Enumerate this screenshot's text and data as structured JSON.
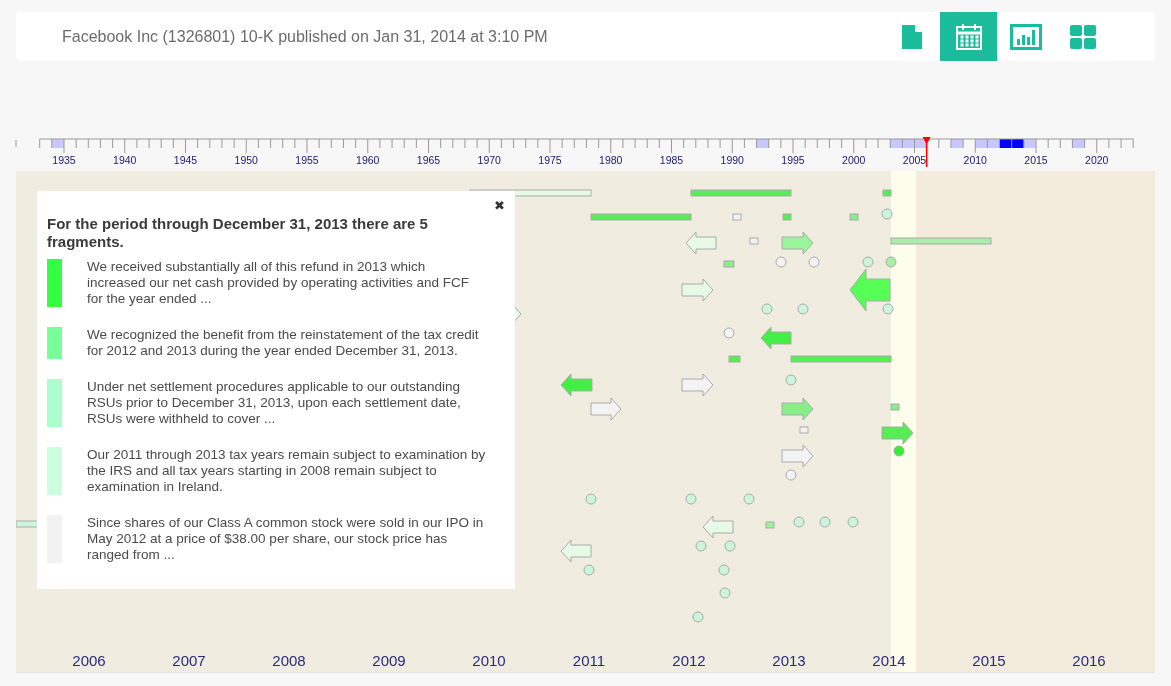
{
  "header": {
    "title": "Facebook Inc (1326801) 10-K published on Jan 31, 2014 at 3:10 PM",
    "views": [
      {
        "kind": "document",
        "selected": false
      },
      {
        "kind": "calendar",
        "selected": true
      },
      {
        "kind": "chart",
        "selected": false
      },
      {
        "kind": "grid",
        "selected": false
      }
    ]
  },
  "ruler": {
    "labels": [
      "1935",
      "1940",
      "1945",
      "1950",
      "1955",
      "1960",
      "1965",
      "1970",
      "1975",
      "1980",
      "1985",
      "1990",
      "1995",
      "2000",
      "2005",
      "2010",
      "2015",
      "2020"
    ]
  },
  "timeline": {
    "years": [
      "2006",
      "2007",
      "2008",
      "2009",
      "2010",
      "2011",
      "2012",
      "2013",
      "2014",
      "2015",
      "2016"
    ]
  },
  "popup": {
    "close": "✖",
    "heading": "For the period through December 31, 2013 there are 5 fragments.",
    "fragments": [
      {
        "color": "#33ff44",
        "text": "We received substantially all of this refund in 2013 which increased our net cash provided by operating activities and FCF for the year ended ..."
      },
      {
        "color": "#77ff99",
        "text": "We recognized the benefit from the reinstatement of the tax credit for 2012 and 2013 during the year ended December 31, 2013."
      },
      {
        "color": "#aaffcc",
        "text": "Under net settlement procedures applicable to our outstanding RSUs prior to December 31, 2013, upon each settlement date, RSUs were withheld to cover ..."
      },
      {
        "color": "#ccffdd",
        "text": "Our 2011 through 2013 tax years remain subject to examination by the IRS and all tax years starting in 2008 remain subject to examination in Ireland."
      },
      {
        "color": "#f2f2f2",
        "text": "Since shares of our Class A common stock were sold in our IPO in May 2012 at a price of $38.00 per share, our stock price has ranged from ..."
      }
    ]
  }
}
